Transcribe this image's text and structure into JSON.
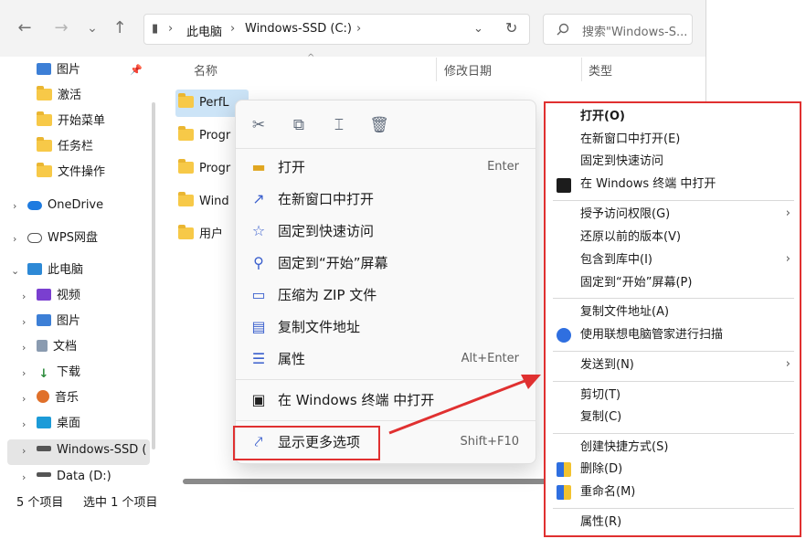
{
  "nav": {
    "back": "←",
    "forward": "→",
    "dropdown": "⌄",
    "up": "↑"
  },
  "address": {
    "root_icon": "▮",
    "crumb1": "此电脑",
    "crumb2": "Windows-SSD (C:)",
    "sep": "›",
    "dropdown": "⌄",
    "refresh": "↻"
  },
  "search": {
    "placeholder": "搜索\"Windows-S..."
  },
  "sidebar": {
    "items": [
      {
        "label": "图片",
        "pinned": true
      },
      {
        "label": "激活"
      },
      {
        "label": "开始菜单"
      },
      {
        "label": "任务栏"
      },
      {
        "label": "文件操作"
      },
      {
        "label": "OneDrive"
      },
      {
        "label": "WPS网盘"
      },
      {
        "label": "此电脑"
      },
      {
        "label": "视频"
      },
      {
        "label": "图片"
      },
      {
        "label": "文档"
      },
      {
        "label": "下载"
      },
      {
        "label": "音乐"
      },
      {
        "label": "桌面"
      },
      {
        "label": "Windows-SSD ("
      },
      {
        "label": "Data (D:)"
      }
    ]
  },
  "columns": {
    "name": "名称",
    "date": "修改日期",
    "type": "类型"
  },
  "files": [
    {
      "name": "PerfL"
    },
    {
      "name": "Progr"
    },
    {
      "name": "Progr"
    },
    {
      "name": "Wind"
    },
    {
      "name": "用户"
    }
  ],
  "status": {
    "count": "5 个项目",
    "selected": "选中 1 个项目"
  },
  "menu11": {
    "quick_actions": [
      "cut-icon",
      "copy-icon",
      "rename-icon",
      "delete-icon"
    ],
    "items": [
      {
        "label": "打开",
        "shortcut": "Enter"
      },
      {
        "label": "在新窗口中打开",
        "shortcut": ""
      },
      {
        "label": "固定到快速访问",
        "shortcut": ""
      },
      {
        "label": "固定到“开始”屏幕",
        "shortcut": ""
      },
      {
        "label": "压缩为 ZIP 文件",
        "shortcut": ""
      },
      {
        "label": "复制文件地址",
        "shortcut": ""
      },
      {
        "label": "属性",
        "shortcut": "Alt+Enter"
      },
      {
        "label": "在 Windows 终端 中打开",
        "shortcut": ""
      },
      {
        "label": "显示更多选项",
        "shortcut": "Shift+F10"
      }
    ]
  },
  "classic_menu": {
    "items": [
      {
        "label": "打开(O)"
      },
      {
        "label": "在新窗口中打开(E)"
      },
      {
        "label": "固定到快速访问"
      },
      {
        "label": "在 Windows 终端 中打开"
      },
      {
        "label": "授予访问权限(G)"
      },
      {
        "label": "还原以前的版本(V)"
      },
      {
        "label": "包含到库中(I)"
      },
      {
        "label": "固定到“开始”屏幕(P)"
      },
      {
        "label": "复制文件地址(A)"
      },
      {
        "label": "使用联想电脑管家进行扫描"
      },
      {
        "label": "发送到(N)"
      },
      {
        "label": "剪切(T)"
      },
      {
        "label": "复制(C)"
      },
      {
        "label": "创建快捷方式(S)"
      },
      {
        "label": "删除(D)"
      },
      {
        "label": "重命名(M)"
      },
      {
        "label": "属性(R)"
      }
    ],
    "arrow": "›"
  },
  "colors": {
    "highlight": "#e03030",
    "folder": "#f7c948",
    "accent": "#3a5fcd"
  }
}
